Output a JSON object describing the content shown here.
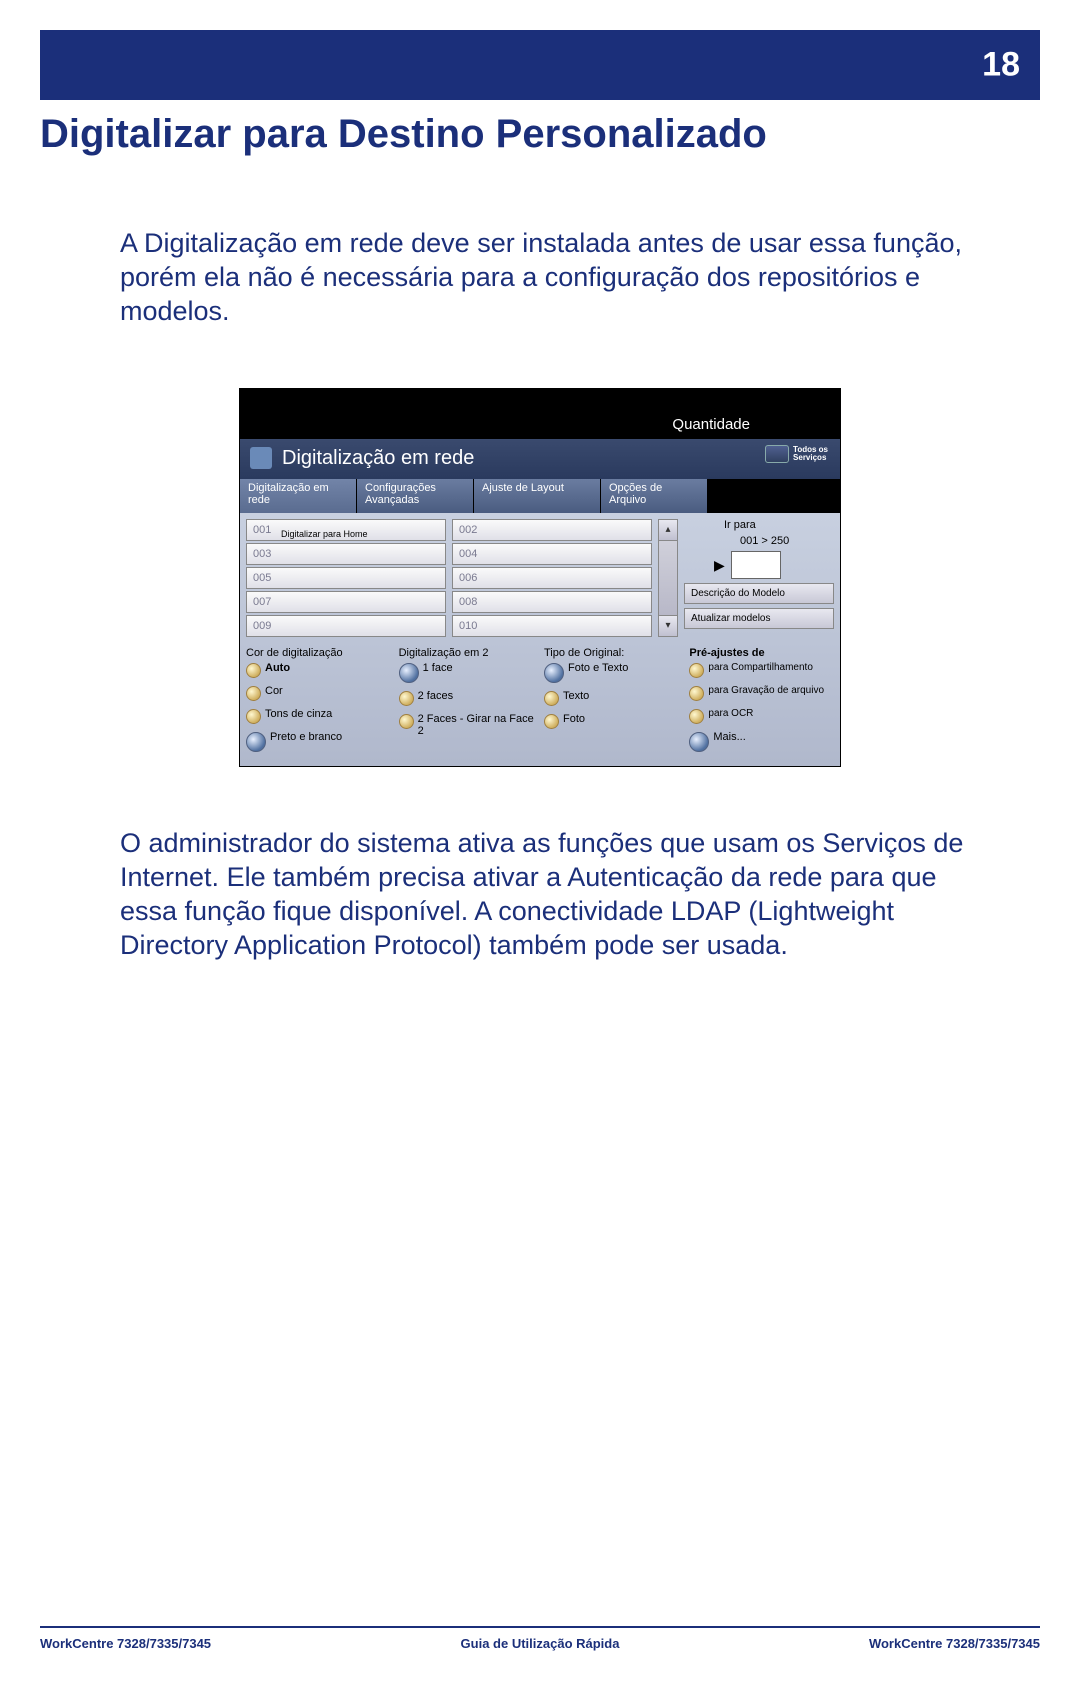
{
  "page_number": "18",
  "title": "Digitalizar para Destino Personalizado",
  "para1": "A Digitalização em rede deve ser instalada antes de usar essa função, porém ela não é necessária para a configuração dos repositórios e modelos.",
  "para2": "O administrador do sistema ativa as funções que usam os Serviços de Internet. Ele também precisa ativar a Autenticação da rede para que essa função fique disponível. A conectividade LDAP (Lightweight Directory Application Protocol) também pode ser usada.",
  "footer": {
    "left": "WorkCentre 7328/7335/7345",
    "center": "Guia de Utilização Rápida",
    "right": "WorkCentre 7328/7335/7345"
  },
  "ui": {
    "quantidade": "Quantidade",
    "panel_title": "Digitalização em rede",
    "all_services": "Todos os\nServiços",
    "tabs": {
      "t1": "Digitalização em rede",
      "t2": "Configurações Avançadas",
      "t3": "Ajuste de Layout",
      "t4": "Opções de Arquivo"
    },
    "list_left": [
      "001",
      "003",
      "005",
      "007",
      "009"
    ],
    "list_left_sub": "Digitalizar para Home",
    "list_right": [
      "002",
      "004",
      "006",
      "008",
      "010"
    ],
    "goto_label": "Ir para",
    "goto_range": "001 > 250",
    "desc_btn": "Descrição do Modelo",
    "update_btn": "Atualizar modelos",
    "col1": {
      "header": "Cor de digitalização",
      "o1": "Auto",
      "o2": "Cor",
      "o3": "Tons de cinza",
      "o4": "Preto e branco"
    },
    "col2": {
      "header": "Digitalização em 2",
      "o1": "1 face",
      "o2": "2 faces",
      "o3": "2 Faces - Girar na Face 2"
    },
    "col3": {
      "header": "Tipo de Original:",
      "o1": "Foto e Texto",
      "o2": "Texto",
      "o3": "Foto"
    },
    "col4": {
      "header": "Pré-ajustes de",
      "o1": "para Compartilhamento",
      "o2": "para Gravação de arquivo",
      "o3": "para OCR",
      "o4": "Mais..."
    }
  }
}
